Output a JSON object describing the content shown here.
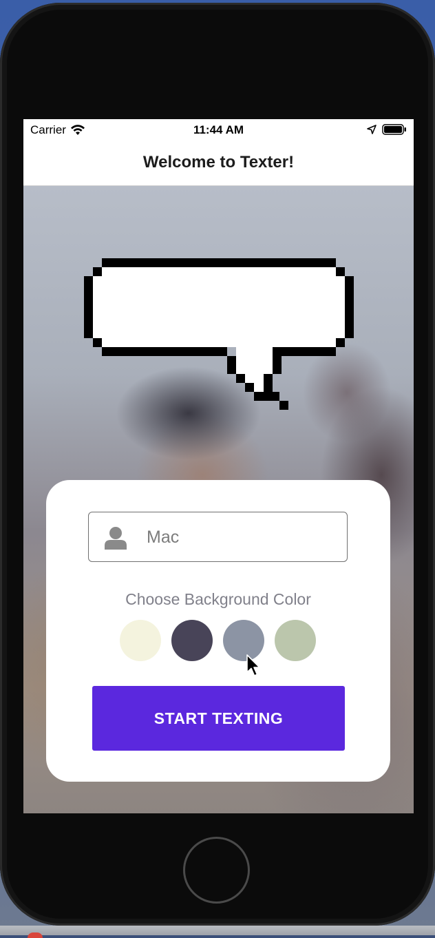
{
  "status_bar": {
    "carrier": "Carrier",
    "time": "11:44 AM",
    "icons": [
      "wifi-icon",
      "location-arrow-icon",
      "battery-icon"
    ]
  },
  "nav": {
    "title": "Welcome to Texter!"
  },
  "form": {
    "name_input": {
      "value": "Mac",
      "icon": "person-icon"
    },
    "color_label": "Choose Background Color",
    "colors": [
      "#F4F3DE",
      "#484458",
      "#8C94A4",
      "#BBC6AC"
    ],
    "start_button_label": "START TEXTING"
  },
  "theme": {
    "accent": "#5B28DE"
  }
}
